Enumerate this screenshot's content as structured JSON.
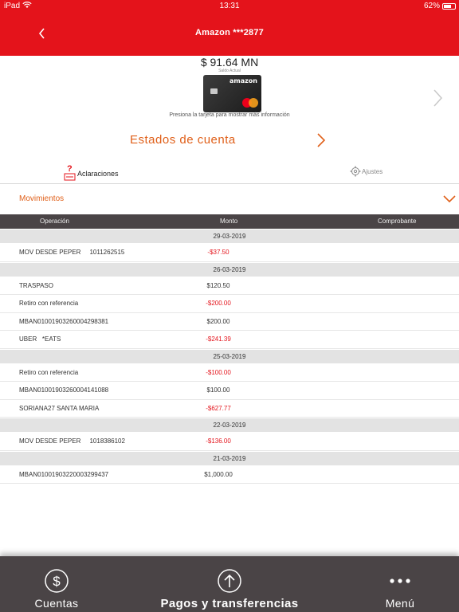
{
  "status_bar": {
    "device": "iPad",
    "time": "13:31",
    "battery": "62%",
    "battery_level": 0.62
  },
  "header": {
    "title": "Amazon ***2877"
  },
  "account": {
    "balance": "$ 91.64 MN",
    "balance_label": "Saldo Actual",
    "card_brand": "amazon",
    "card_hint": "Presiona la tarjeta para mostrar más información"
  },
  "statements": {
    "label": "Estados de cuenta"
  },
  "subtabs": {
    "aclaraciones": "Aclaraciones",
    "ajustes": "Ajustes"
  },
  "movements": {
    "label": "Movimientos",
    "columns": [
      "Operación",
      "Monto",
      "Comprobante"
    ],
    "groups": [
      {
        "date": "29-03-2019",
        "items": [
          {
            "desc": "MOV DESDE PEPER     1011262515",
            "amount": "-$37.50",
            "negative": true
          }
        ]
      },
      {
        "date": "26-03-2019",
        "items": [
          {
            "desc": "TRASPASO",
            "amount": "$120.50",
            "negative": false
          },
          {
            "desc": "Retiro con referencia",
            "amount": "-$200.00",
            "negative": true
          },
          {
            "desc": "MBAN01001903260004298381",
            "amount": "$200.00",
            "negative": false
          },
          {
            "desc": "UBER   *EATS",
            "amount": "-$241.39",
            "negative": true
          }
        ]
      },
      {
        "date": "25-03-2019",
        "items": [
          {
            "desc": "Retiro con referencia",
            "amount": "-$100.00",
            "negative": true
          },
          {
            "desc": "MBAN01001903260004141088",
            "amount": "$100.00",
            "negative": false
          },
          {
            "desc": "SORIANA27 SANTA MARIA",
            "amount": "-$627.77",
            "negative": true
          }
        ]
      },
      {
        "date": "22-03-2019",
        "items": [
          {
            "desc": "MOV DESDE PEPER     1018386102",
            "amount": "-$136.00",
            "negative": true
          }
        ]
      },
      {
        "date": "21-03-2019",
        "items": [
          {
            "desc": "MBAN01001903220003299437",
            "amount": "$1,000.00",
            "negative": false
          }
        ]
      }
    ]
  },
  "tabbar": {
    "cuentas": "Cuentas",
    "pagos": "Pagos y transferencias",
    "menu": "Menú"
  },
  "colors": {
    "brand_red": "#e4131b",
    "accent_orange": "#e0601a",
    "bar_dark": "#4a4446"
  },
  "icons": {
    "back": "chevron-left-icon",
    "card_next": "chevron-right-icon",
    "statements": "chevron-right-icon",
    "aclaraciones": "question-icon",
    "ajustes": "gear-icon",
    "movements_toggle": "chevron-down-icon",
    "cuentas": "dollar-circle-icon",
    "pagos": "arrow-up-circle-icon",
    "menu": "more-dots-icon"
  }
}
